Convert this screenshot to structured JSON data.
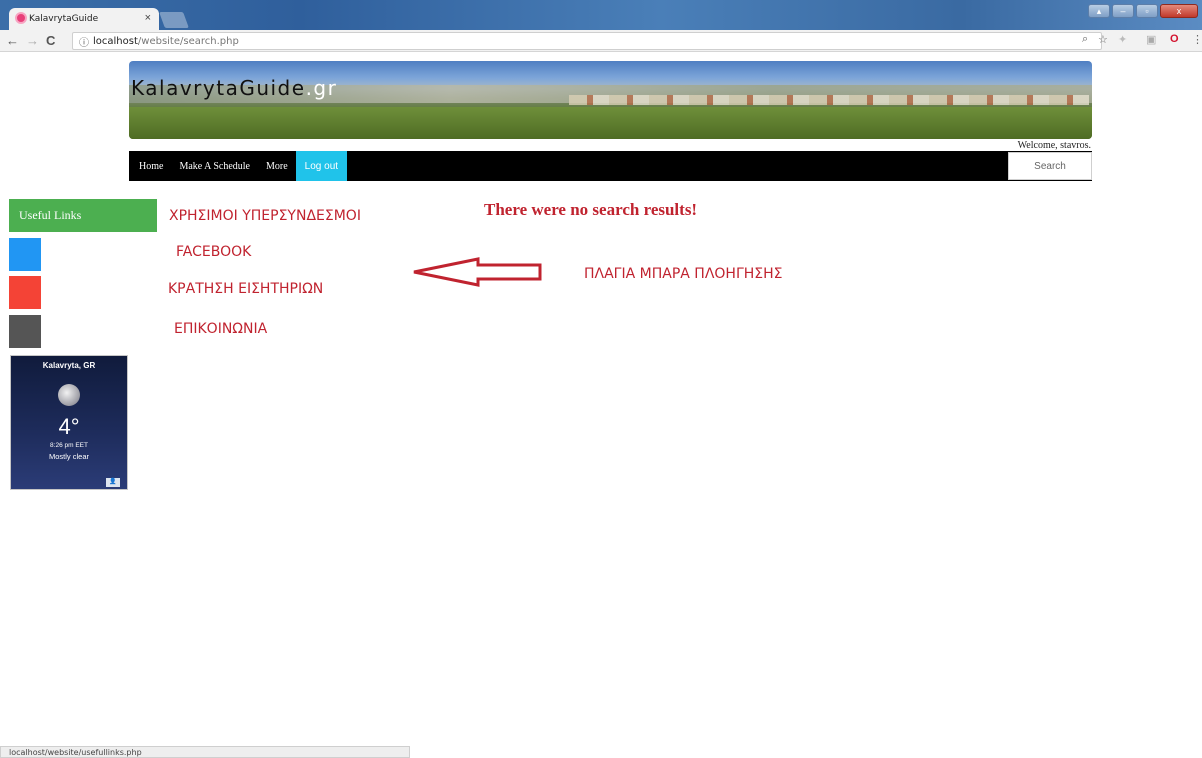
{
  "browser": {
    "tab_title": "KalavrytaGuide",
    "tab_close": "×",
    "url_host": "localhost",
    "url_path": "/website/search.php",
    "status_url": "localhost/website/usefullinks.php"
  },
  "site": {
    "title": "KalavrytaGuide",
    "title_tld": ".gr",
    "welcome": "Welcome, stavros."
  },
  "nav": {
    "items": [
      {
        "label": "Home"
      },
      {
        "label": "Make A Schedule"
      },
      {
        "label": "More"
      }
    ],
    "logout": "Log out",
    "search_placeholder": "Search"
  },
  "sidebar": {
    "header": "Useful Links",
    "links": [
      {
        "color": "#2196f3",
        "name": "facebook"
      },
      {
        "color": "#f44336",
        "name": "ticket-booking"
      },
      {
        "color": "#555555",
        "name": "contact"
      }
    ]
  },
  "weather": {
    "city": "Kalavryta, GR",
    "temp": "4°",
    "time": "8:26 pm EET",
    "condition": "Mostly clear"
  },
  "main": {
    "no_results": "There were no search results!"
  },
  "annotations": {
    "useful_links": "ΧΡΗΣΙΜΟΙ ΥΠΕΡΣΥΝΔΕΣΜΟΙ",
    "facebook": "FACEBOOK",
    "tickets": "ΚΡΑΤΗΣΗ ΕΙΣΗΤΗΡΙΩΝ",
    "contact": "ΕΠΙΚΟΙΝΩΝΙΑ",
    "sidebar": "ΠΛΑΓΙΑ ΜΠΑΡΑ ΠΛΟΗΓΗΣΗΣ"
  },
  "colors": {
    "accent_green": "#4caf50",
    "logout_cyan": "#20c3ea",
    "annotation_red": "#c0232f"
  }
}
